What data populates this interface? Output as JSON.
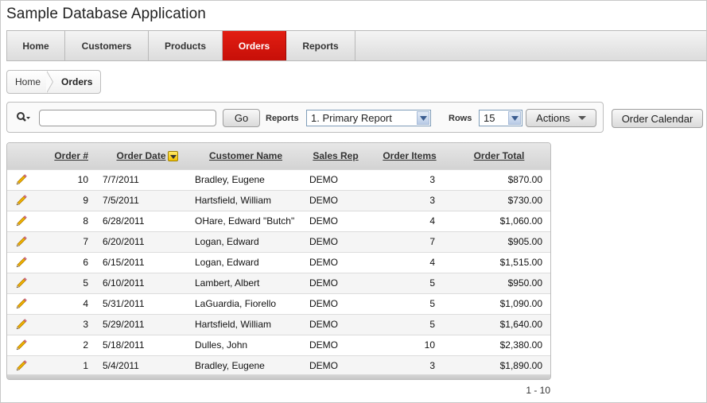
{
  "app": {
    "title": "Sample Database Application"
  },
  "tabs": [
    {
      "label": "Home",
      "active": false
    },
    {
      "label": "Customers",
      "active": false
    },
    {
      "label": "Products",
      "active": false
    },
    {
      "label": "Orders",
      "active": true
    },
    {
      "label": "Reports",
      "active": false
    }
  ],
  "breadcrumb": {
    "home": "Home",
    "current": "Orders"
  },
  "search": {
    "value": "",
    "go_label": "Go",
    "reports_label": "Reports",
    "reports_selected": "1. Primary Report",
    "rows_label": "Rows",
    "rows_selected": "15",
    "actions_label": "Actions"
  },
  "order_calendar_label": "Order Calendar",
  "table": {
    "columns": [
      "Order #",
      "Order Date",
      "Customer Name",
      "Sales Rep",
      "Order Items",
      "Order Total"
    ],
    "rows": [
      {
        "order": "10",
        "date": "7/7/2011",
        "customer": "Bradley, Eugene",
        "rep": "DEMO",
        "items": "3",
        "total": "$870.00"
      },
      {
        "order": "9",
        "date": "7/5/2011",
        "customer": "Hartsfield, William",
        "rep": "DEMO",
        "items": "3",
        "total": "$730.00"
      },
      {
        "order": "8",
        "date": "6/28/2011",
        "customer": "OHare, Edward \"Butch\"",
        "rep": "DEMO",
        "items": "4",
        "total": "$1,060.00"
      },
      {
        "order": "7",
        "date": "6/20/2011",
        "customer": "Logan, Edward",
        "rep": "DEMO",
        "items": "7",
        "total": "$905.00"
      },
      {
        "order": "6",
        "date": "6/15/2011",
        "customer": "Logan, Edward",
        "rep": "DEMO",
        "items": "4",
        "total": "$1,515.00"
      },
      {
        "order": "5",
        "date": "6/10/2011",
        "customer": "Lambert, Albert",
        "rep": "DEMO",
        "items": "5",
        "total": "$950.00"
      },
      {
        "order": "4",
        "date": "5/31/2011",
        "customer": "LaGuardia, Fiorello",
        "rep": "DEMO",
        "items": "5",
        "total": "$1,090.00"
      },
      {
        "order": "3",
        "date": "5/29/2011",
        "customer": "Hartsfield, William",
        "rep": "DEMO",
        "items": "5",
        "total": "$1,640.00"
      },
      {
        "order": "2",
        "date": "5/18/2011",
        "customer": "Dulles, John",
        "rep": "DEMO",
        "items": "10",
        "total": "$2,380.00"
      },
      {
        "order": "1",
        "date": "5/4/2011",
        "customer": "Bradley, Eugene",
        "rep": "DEMO",
        "items": "3",
        "total": "$1,890.00"
      }
    ]
  },
  "pager": "1 - 10",
  "colors": {
    "active_tab": "#d8170d",
    "pencil": "#f2b400"
  },
  "icons": {
    "edit": "pencil-icon",
    "search": "search-icon",
    "sort": "sort-desc-icon"
  }
}
